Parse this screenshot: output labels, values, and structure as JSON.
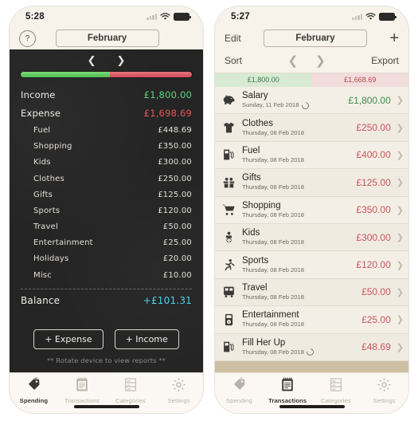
{
  "left_phone": {
    "status": {
      "time": "5:28",
      "wifi_icon": "wifi-icon",
      "battery_icon": "battery-icon",
      "signal_icon": "signal-icon"
    },
    "nav": {
      "help_label": "?",
      "month_label": "February",
      "prev_icon": "chevron-left-icon",
      "next_icon": "chevron-right-icon"
    },
    "ratio": {
      "income_percent": 52,
      "expense_percent": 48
    },
    "summary": [
      {
        "label": "Income",
        "amount": "£1,800.00",
        "kind": "income",
        "indent": false
      },
      {
        "label": "Expense",
        "amount": "£1,698.69",
        "kind": "expense",
        "indent": false
      }
    ],
    "categories": [
      {
        "label": "Fuel",
        "amount": "£448.69"
      },
      {
        "label": "Shopping",
        "amount": "£350.00"
      },
      {
        "label": "Kids",
        "amount": "£300.00"
      },
      {
        "label": "Clothes",
        "amount": "£250.00"
      },
      {
        "label": "Gifts",
        "amount": "£125.00"
      },
      {
        "label": "Sports",
        "amount": "£120.00"
      },
      {
        "label": "Travel",
        "amount": "£50.00"
      },
      {
        "label": "Entertainment",
        "amount": "£25.00"
      },
      {
        "label": "Holidays",
        "amount": "£20.00"
      },
      {
        "label": "Misc",
        "amount": "£10.00"
      }
    ],
    "balance": {
      "label": "Balance",
      "amount": "+£101.31"
    },
    "actions": {
      "expense_label": "+ Expense",
      "income_label": "+ Income",
      "note": "** Rotate device to view reports **"
    },
    "tabs": [
      {
        "label": "Spending",
        "icon": "price-tag-icon",
        "active": true
      },
      {
        "label": "Transactions",
        "icon": "notepad-icon",
        "active": false
      },
      {
        "label": "Categories",
        "icon": "list-grid-icon",
        "active": false
      },
      {
        "label": "Settings",
        "icon": "gear-icon",
        "active": false
      }
    ]
  },
  "right_phone": {
    "status": {
      "time": "5:27",
      "wifi_icon": "wifi-icon",
      "battery_icon": "battery-icon",
      "signal_icon": "signal-icon"
    },
    "nav": {
      "edit_label": "Edit",
      "month_label": "February",
      "add_icon": "plus-icon"
    },
    "subbar": {
      "sort_label": "Sort",
      "export_label": "Export",
      "prev_icon": "chevron-left-icon",
      "next_icon": "chevron-right-icon"
    },
    "totals": {
      "income": "£1,800.00",
      "expense": "£1,668.69"
    },
    "transactions": [
      {
        "title": "Salary",
        "date": "Sunday, 11 Feb 2018",
        "amount": "£1,800.00",
        "kind": "pos",
        "icon": "piggy-bank-icon",
        "recurring": true
      },
      {
        "title": "Clothes",
        "date": "Thursday, 08 Feb 2018",
        "amount": "£250.00",
        "kind": "neg",
        "icon": "tshirt-icon",
        "recurring": false
      },
      {
        "title": "Fuel",
        "date": "Thursday, 08 Feb 2018",
        "amount": "£400.00",
        "kind": "neg",
        "icon": "fuel-pump-icon",
        "recurring": false
      },
      {
        "title": "Gifts",
        "date": "Thursday, 08 Feb 2018",
        "amount": "£125.00",
        "kind": "neg",
        "icon": "gift-icon",
        "recurring": false
      },
      {
        "title": "Shopping",
        "date": "Thursday, 08 Feb 2018",
        "amount": "£350.00",
        "kind": "neg",
        "icon": "shopping-cart-icon",
        "recurring": false
      },
      {
        "title": "Kids",
        "date": "Thursday, 08 Feb 2018",
        "amount": "£300.00",
        "kind": "neg",
        "icon": "child-icon",
        "recurring": false
      },
      {
        "title": "Sports",
        "date": "Thursday, 08 Feb 2018",
        "amount": "£120.00",
        "kind": "neg",
        "icon": "runner-icon",
        "recurring": false
      },
      {
        "title": "Travel",
        "date": "Thursday, 08 Feb 2018",
        "amount": "£50.00",
        "kind": "neg",
        "icon": "bus-icon",
        "recurring": false
      },
      {
        "title": "Entertainment",
        "date": "Thursday, 08 Feb 2018",
        "amount": "£25.00",
        "kind": "neg",
        "icon": "media-player-icon",
        "recurring": false
      },
      {
        "title": "Fill Her Up",
        "date": "Thursday, 08 Feb 2018",
        "amount": "£48.69",
        "kind": "neg",
        "icon": "fuel-pump-icon",
        "recurring": true
      }
    ],
    "tabs": [
      {
        "label": "Spending",
        "icon": "price-tag-icon",
        "active": false
      },
      {
        "label": "Transactions",
        "icon": "notepad-icon",
        "active": true
      },
      {
        "label": "Categories",
        "icon": "list-grid-icon",
        "active": false
      },
      {
        "label": "Settings",
        "icon": "gear-icon",
        "active": false
      }
    ]
  },
  "colors": {
    "income_green": "#62d47f",
    "expense_red": "#e05a5a",
    "balance_blue": "#4fd2e8",
    "board_bg": "#242424",
    "paper_bg": "#f4efe6",
    "tan_bg": "#cdbfa4"
  }
}
